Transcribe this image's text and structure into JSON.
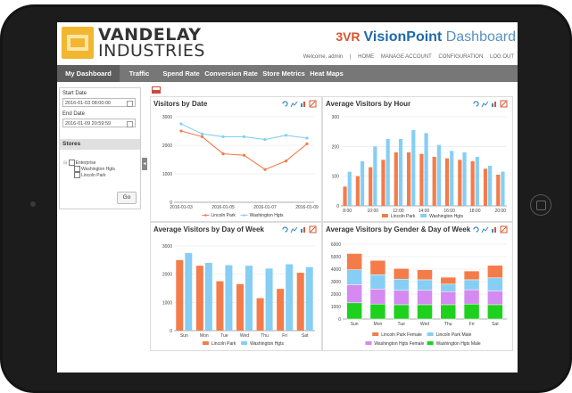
{
  "brand": {
    "line1": "VANDELAY",
    "line2": "INDUSTRIES"
  },
  "visionpoint": {
    "mark": "3VR",
    "name": "VisionPoint",
    "suffix": "Dashboard"
  },
  "toplinks": {
    "welcome": "Welcome, admin",
    "sep": "|",
    "home": "HOME",
    "manage": "MANAGE ACCOUNT",
    "config": "CONFIGURATION",
    "logout": "LOG OUT"
  },
  "nav": [
    "My Dashboard",
    "Traffic",
    "Spend Rate",
    "Conversion Rate",
    "Store Metrics",
    "Heat Maps"
  ],
  "sidebar": {
    "start_label": "Start Date",
    "start_value": "2016-01-03 08:00:00",
    "end_label": "End Date",
    "end_value": "2016-01-09 20:59:59",
    "stores_label": "Stores",
    "tree": [
      "Enterprise",
      "Washington Hgts",
      "Lincoln Park"
    ],
    "go_label": "Go"
  },
  "colors": {
    "orange": "#f47c4a",
    "blue": "#86cef4",
    "purple": "#d48af0",
    "green": "#1ed11e",
    "accent_blue": "#1e6aa8"
  },
  "chart_data": [
    {
      "type": "line",
      "title": "Visitors by Date",
      "x": [
        "2016-01-03",
        "2016-01-04",
        "2016-01-05",
        "2016-01-06",
        "2016-01-07",
        "2016-01-08",
        "2016-01-09"
      ],
      "xticks": [
        "2016-01-03",
        "2016-01-05",
        "2016-01-07",
        "2016-01-09"
      ],
      "ylim": [
        0,
        3000
      ],
      "yticks": [
        0,
        1000,
        2000,
        3000
      ],
      "series": [
        {
          "name": "Lincoln Park",
          "values": [
            2500,
            2300,
            1700,
            1650,
            1150,
            1450,
            2050
          ]
        },
        {
          "name": "Washington Hgts",
          "values": [
            2750,
            2400,
            2300,
            2300,
            2200,
            2350,
            2250
          ]
        }
      ]
    },
    {
      "type": "bar",
      "title": "Average Visitors by Hour",
      "categories": [
        "8",
        "9",
        "10",
        "11",
        "12",
        "13",
        "14",
        "15",
        "16",
        "17",
        "18",
        "19",
        "20"
      ],
      "xticks": [
        "8:00",
        "10:00",
        "12:00",
        "14:00",
        "16:00",
        "18:00",
        "20:00"
      ],
      "ylim": [
        0,
        300
      ],
      "yticks": [
        0,
        100,
        200,
        300
      ],
      "series": [
        {
          "name": "Lincoln Park",
          "values": [
            65,
            100,
            130,
            155,
            180,
            180,
            175,
            165,
            160,
            155,
            150,
            125,
            105
          ]
        },
        {
          "name": "Washington Hgts",
          "values": [
            115,
            150,
            200,
            225,
            225,
            255,
            245,
            205,
            185,
            180,
            165,
            135,
            115
          ]
        }
      ]
    },
    {
      "type": "bar",
      "title": "Average Visitors by Day of Week",
      "categories": [
        "Sun",
        "Mon",
        "Tue",
        "Wed",
        "Thu",
        "Fri",
        "Sat"
      ],
      "ylim": [
        0,
        3000
      ],
      "yticks": [
        0,
        1000,
        2000,
        3000
      ],
      "series": [
        {
          "name": "Lincoln Park",
          "values": [
            2500,
            2300,
            1750,
            1650,
            1150,
            1480,
            2050
          ]
        },
        {
          "name": "Washington Hgts",
          "values": [
            2750,
            2400,
            2320,
            2300,
            2200,
            2350,
            2250
          ]
        }
      ]
    },
    {
      "type": "bar",
      "title": "Average Visitors by Gender & Day of Week",
      "categories": [
        "Sun",
        "Mon",
        "Tue",
        "Wed",
        "Thu",
        "Fri",
        "Sat"
      ],
      "ylim": [
        0,
        6000
      ],
      "yticks": [
        0,
        1000,
        2000,
        3000,
        4000,
        5000,
        6000
      ],
      "stacked": true,
      "series": [
        {
          "name": "Washington Hgts Male",
          "values": [
            1300,
            1200,
            1150,
            1150,
            1150,
            1200,
            1150
          ]
        },
        {
          "name": "Washington Hgts Female",
          "values": [
            1450,
            1200,
            1150,
            1150,
            1050,
            1150,
            1100
          ]
        },
        {
          "name": "Lincoln Park Male",
          "values": [
            1200,
            1150,
            900,
            850,
            600,
            800,
            1050
          ]
        },
        {
          "name": "Lincoln Park Female",
          "values": [
            1300,
            1150,
            850,
            800,
            550,
            700,
            1000
          ]
        }
      ]
    }
  ]
}
